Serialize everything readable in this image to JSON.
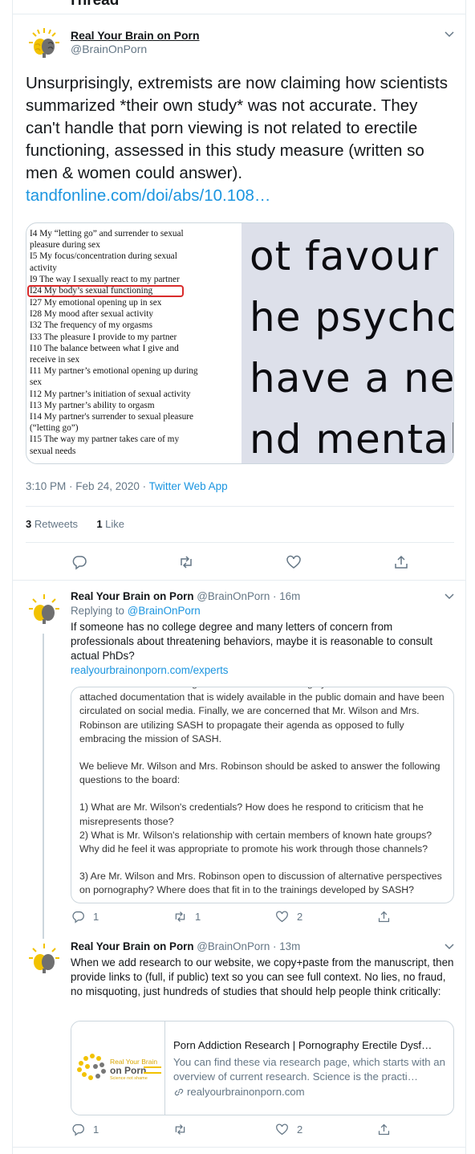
{
  "header": {
    "title": "Thread"
  },
  "main_tweet": {
    "name": "Real Your Brain on Porn",
    "handle": "@BrainOnPorn",
    "text": "Unsurprisingly, extremists are now claiming how scientists summarized *their own study* was not accurate. They can't handle that porn viewing is not related to erectile functioning, assessed in this study measure (written so men & women could answer).",
    "link": "tandfonline.com/doi/abs/10.108…",
    "image_left_lines": [
      "I4 My “letting go” and surrender to sexual",
      "pleasure during sex",
      "I5 My focus/concentration during sexual",
      "activity",
      "I9 The way I sexually react to my partner",
      "I24 My body’s sexual functioning",
      "I27 My emotional opening up in sex",
      "I28 My mood after sexual activity",
      "I32 The frequency of my orgasms",
      "I33 The pleasure I provide to my partner",
      "I10 The balance between what I give and",
      "receive in sex",
      "I11 My partner’s emotional opening up during",
      "sex",
      "I12 My partner’s initiation of sexual activity",
      "I13 My partner’s ability to orgasm",
      "I14 My partner's surrender to sexual pleasure",
      "(“letting go”)",
      "I15 The way my partner takes care of my",
      "sexual needs"
    ],
    "highlighted_line_index": 5,
    "image_right_lines": [
      "ot  favour",
      "he psycho",
      "have a ne",
      "nd mental"
    ],
    "timestamp": "3:10 PM · Feb 24, 2020",
    "source": "Twitter Web App",
    "retweets_count": "3",
    "retweets_label": "Retweets",
    "likes_count": "1",
    "likes_label": "Like"
  },
  "reply1": {
    "name": "Real Your Brain on Porn",
    "handle": "@BrainOnPorn",
    "time": "· 16m",
    "replying_prefix": "Replying to",
    "replying_handle": "@BrainOnPorn",
    "text": "If someone has no college degree and many letters of concern from professionals about threatening behaviors, maybe it is reasonable to consult actual PhDs?",
    "link": "realyourbrainonporn.com/experts",
    "doc_paragraphs": [
      "information has come to light about Mr. Wilson's integrity and motivation that attached documentation that is widely available in the public domain and have been circulated on social media. Finally, we are concerned that Mr. Wilson and Mrs. Robinson are utilizing SASH to propagate their agenda as opposed to fully embracing the mission of SASH.",
      "We believe Mr. Wilson and Mrs. Robinson should be asked to answer the following questions to the board:",
      "1) What are Mr. Wilson's credentials? How does he respond to criticism that he misrepresents those?",
      "2) What is Mr. Wilson's relationship with certain members of known hate groups? Why did he feel it was appropriate to promote his work through those channels?",
      "3) Are Mr. Wilson and Mrs. Robinson open to discussion of alternative perspectives on pornography? Where does that fit in to the trainings developed by SASH?"
    ],
    "replies": "1",
    "retweets": "1",
    "likes": "2"
  },
  "reply2": {
    "name": "Real Your Brain on Porn",
    "handle": "@BrainOnPorn",
    "time": "· 13m",
    "text": "When we add research to our website, we copy+paste from the manuscript, then provide links to (full, if public) text so you can see full context. No lies, no fraud, no misquoting, just hundreds of studies that should help people think critically:",
    "card": {
      "logo_line1": "Real Your Brain",
      "logo_line2": "on Porn",
      "logo_line3": "Science not shame",
      "title": "Porn Addiction Research | Pornography Erectile Dysf…",
      "description": "You can find these via research page, which starts with an overview of current research. Science is the practi…",
      "url": "realyourbrainonporn.com"
    },
    "replies": "1",
    "retweets": "",
    "likes": "2"
  },
  "colors": {
    "accent": "#1b95e0",
    "muted": "#657786",
    "border": "#e6ecf0",
    "highlight": "#d92b2b"
  }
}
